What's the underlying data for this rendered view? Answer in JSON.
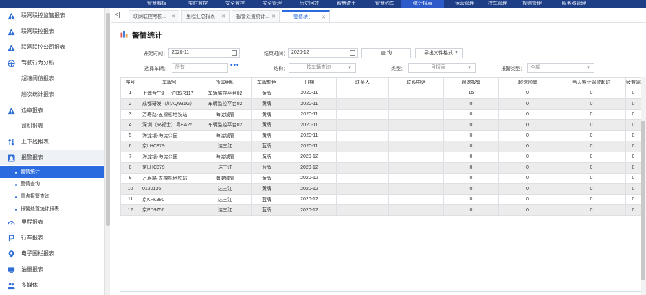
{
  "topnav": [
    "智慧看板",
    "实时监控",
    "安全监控",
    "安全管理",
    "历史回放",
    "智慧渣土",
    "智慧约车",
    "统计报表",
    "运营管理",
    "校车管理",
    "规则管理",
    "服务器管理"
  ],
  "topnav_active": 7,
  "sidebar": {
    "items": [
      {
        "label": "联网联控监管报表",
        "icon": "warning-icon"
      },
      {
        "label": "联网联控报表",
        "icon": "warning-icon"
      },
      {
        "label": "联网联控公司报表",
        "icon": "warning-icon"
      },
      {
        "label": "驾驶行为分析",
        "icon": "steering-wheel-icon"
      },
      {
        "label": "超速阈值报表",
        "icon": ""
      },
      {
        "label": "趟次统计报表",
        "icon": ""
      },
      {
        "label": "违章报表",
        "icon": "warning-icon"
      },
      {
        "label": "司机报表",
        "icon": ""
      },
      {
        "label": "上下线报表",
        "icon": "up-down-arrows-icon"
      },
      {
        "label": "报警报表",
        "icon": "alarm-icon"
      }
    ],
    "sub_items": [
      "警情统计",
      "警情查询",
      "重点报警查询",
      "报警处置统计报表"
    ],
    "items_after": [
      {
        "label": "里程报表",
        "icon": "speedometer-icon"
      },
      {
        "label": "行车报表",
        "icon": "parking-icon"
      },
      {
        "label": "电子围栏报表",
        "icon": "location-pin-icon"
      },
      {
        "label": "油量报表",
        "icon": "monitor-icon"
      },
      {
        "label": "多媒体",
        "icon": "people-icon"
      }
    ]
  },
  "tabs": [
    {
      "label": "联网联控考核..."
    },
    {
      "label": "里程汇总报表"
    },
    {
      "label": "报警处置统计..."
    },
    {
      "label": "警情统计"
    }
  ],
  "tab_collapse": "<|",
  "page_title": "警情统计",
  "filters": {
    "start_label": "开始时间：",
    "start_value": "2020-11",
    "end_label": "结束时间：",
    "end_value": "2020-12",
    "query_button": "查 询",
    "export_button": "导出文件格式",
    "vehicle_label": "选择车辆：",
    "vehicle_placeholder": "所有",
    "structure_label": "结构：",
    "structure_value": "按车辆查询",
    "type_label": "类型：",
    "type_value": "月报表",
    "alarm_type_label": "报警类型：",
    "alarm_type_value": "全部"
  },
  "table": {
    "headers": [
      "序号",
      "车牌号",
      "所属组织",
      "车牌颜色",
      "日期",
      "联系人",
      "联系电话",
      "超速报警",
      "超速预警",
      "当天累计驾驶超时",
      "疲劳驾"
    ],
    "rows": [
      [
        "1",
        "上海合生汇（沪BSR117",
        "车辆监控平台02",
        "黄牌",
        "2020-11",
        "",
        "",
        "15",
        "0",
        "0",
        "0"
      ],
      [
        "2",
        "成都研发（川AQ931G）",
        "车辆监控平台02",
        "黄牌",
        "2020-11",
        "",
        "",
        "0",
        "0",
        "0",
        "0"
      ],
      [
        "3",
        "万寿路-五棵松地铁站",
        "海淀城管",
        "黄牌",
        "2020-11",
        "",
        "",
        "0",
        "0",
        "0",
        "0"
      ],
      [
        "4",
        "深圳（来福士）粤BA25",
        "车辆监控平台02",
        "黄牌",
        "2020-11",
        "",
        "",
        "0",
        "0",
        "0",
        "0"
      ],
      [
        "5",
        "海淀镇-海淀公园",
        "海淀城管",
        "黄牌",
        "2020-11",
        "",
        "",
        "0",
        "0",
        "0",
        "0"
      ],
      [
        "6",
        "京LHC879",
        "达三江",
        "蓝牌",
        "2020-11",
        "",
        "",
        "0",
        "0",
        "0",
        "0"
      ],
      [
        "7",
        "海淀镇-海淀公园",
        "海淀城管",
        "黄牌",
        "2020-12",
        "",
        "",
        "0",
        "0",
        "0",
        "0"
      ],
      [
        "8",
        "京LHC879",
        "达三江",
        "蓝牌",
        "2020-12",
        "",
        "",
        "0",
        "0",
        "0",
        "0"
      ],
      [
        "9",
        "万寿路-五棵松地铁站",
        "海淀城管",
        "黄牌",
        "2020-12",
        "",
        "",
        "0",
        "0",
        "0",
        "0"
      ],
      [
        "10",
        "0120136",
        "达三江",
        "黄牌",
        "2020-12",
        "",
        "",
        "0",
        "0",
        "0",
        "0"
      ],
      [
        "11",
        "京KFK980",
        "达三江",
        "蓝牌",
        "2020-12",
        "",
        "",
        "0",
        "0",
        "0",
        "0"
      ],
      [
        "12",
        "京PD9756",
        "达三江",
        "蓝牌",
        "2020-12",
        "",
        "",
        "0",
        "0",
        "0",
        "0"
      ]
    ]
  },
  "colors": {
    "accent": "#2b6be0",
    "nav": "#1e3f86",
    "warning": "#2f6fd6"
  }
}
